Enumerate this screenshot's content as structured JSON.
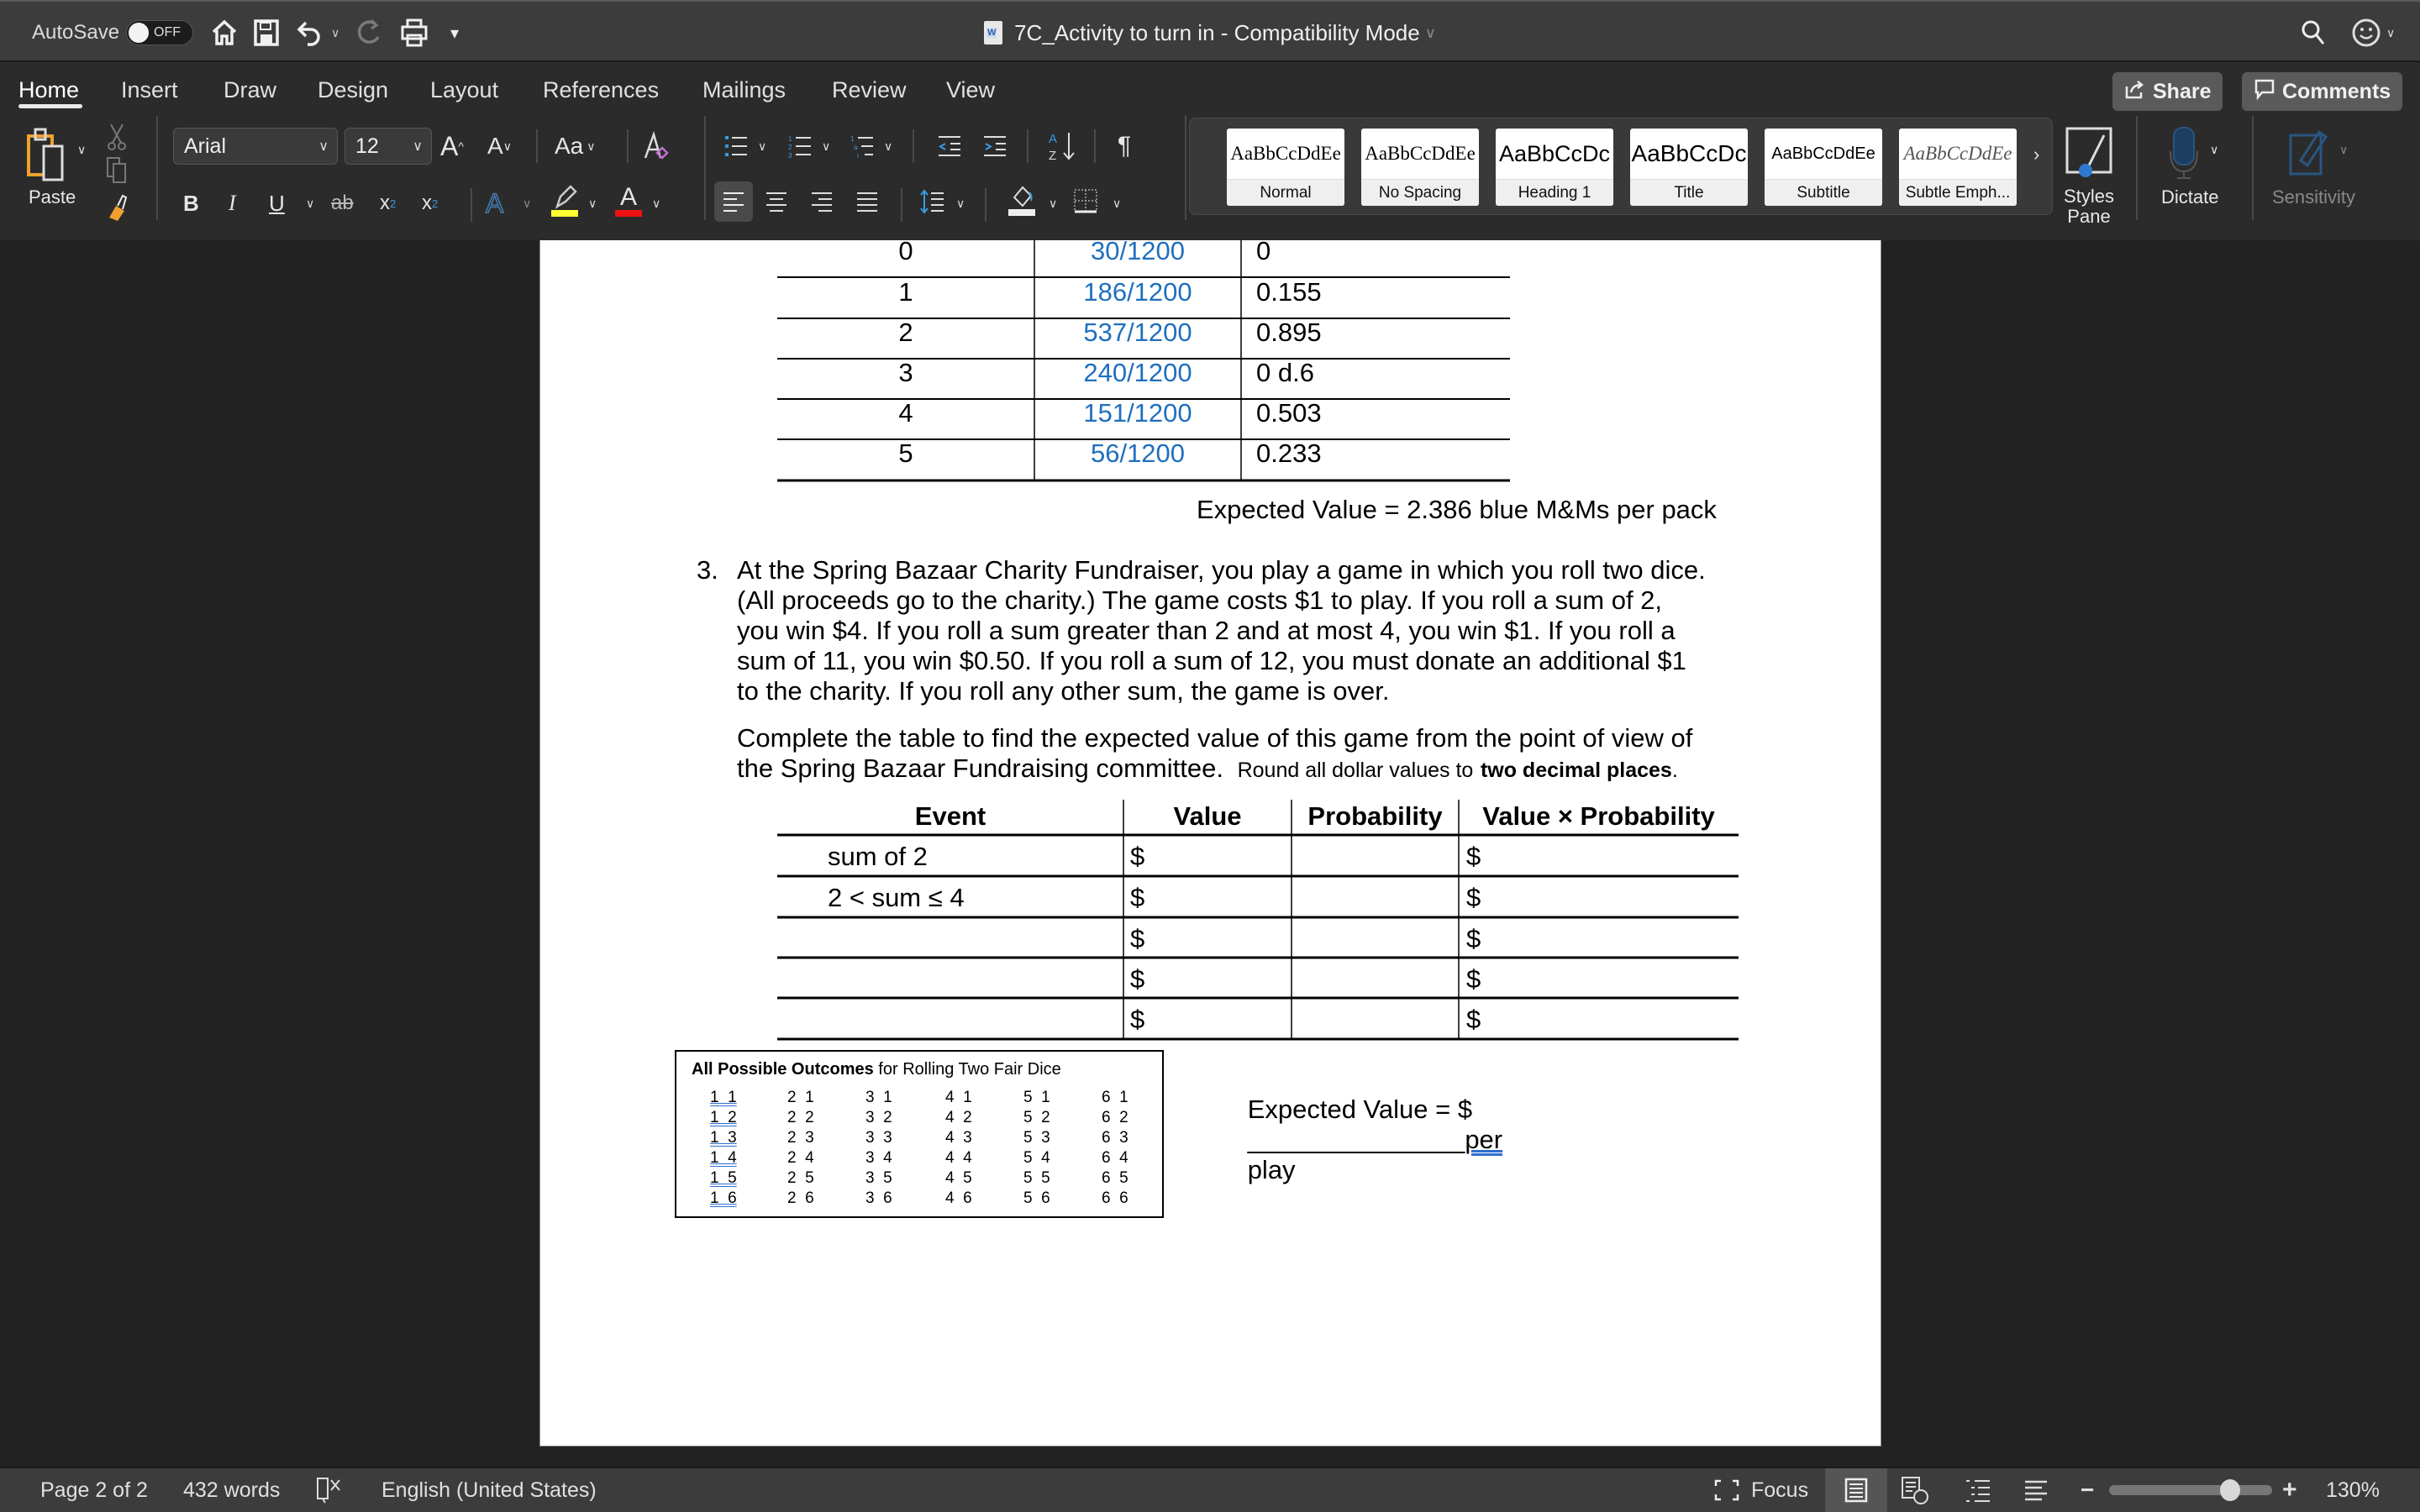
{
  "titlebar": {
    "autosave_label": "AutoSave",
    "autosave_state": "OFF",
    "doc_title": "7C_Activity to turn in  -  Compatibility Mode",
    "icons": [
      "home-icon",
      "save-icon",
      "undo-icon",
      "redo-icon",
      "print-icon",
      "customize-toolbar-icon",
      "search-icon",
      "feedback-smiley-icon"
    ]
  },
  "ribbon": {
    "tabs": [
      {
        "label": "Home",
        "active": true
      },
      {
        "label": "Insert"
      },
      {
        "label": "Draw"
      },
      {
        "label": "Design"
      },
      {
        "label": "Layout"
      },
      {
        "label": "References"
      },
      {
        "label": "Mailings"
      },
      {
        "label": "Review"
      },
      {
        "label": "View"
      }
    ],
    "share_label": "Share",
    "comments_label": "Comments",
    "paste_label": "Paste",
    "font_name": "Arial",
    "font_size": "12",
    "change_case_label": "Aa",
    "styles": [
      {
        "sample": "AaBbCcDdEe",
        "label": "Normal"
      },
      {
        "sample": "AaBbCcDdEe",
        "label": "No Spacing"
      },
      {
        "sample": "AaBbCcDc",
        "label": "Heading 1"
      },
      {
        "sample": "AaBbCcDc",
        "label": "Title"
      },
      {
        "sample": "AaBbCcDdEe",
        "label": "Subtitle"
      },
      {
        "sample": "AaBbCcDdEe",
        "label": "Subtle Emph..."
      }
    ],
    "styles_pane_label": "Styles Pane",
    "dictate_label": "Dictate",
    "sensitivity_label": "Sensitivity",
    "colors": {
      "highlight": "#ffff33",
      "font_color": "#ee1111"
    }
  },
  "document": {
    "prob_table": {
      "rows": [
        {
          "x": "0",
          "freq": "30/1200",
          "product": "0"
        },
        {
          "x": "1",
          "freq": "186/1200",
          "product": "0.155"
        },
        {
          "x": "2",
          "freq": "537/1200",
          "product": "0.895"
        },
        {
          "x": "3",
          "freq": "240/1200",
          "product": "0 d.6"
        },
        {
          "x": "4",
          "freq": "151/1200",
          "product": "0.503"
        },
        {
          "x": "5",
          "freq": "56/1200",
          "product": "0.233"
        }
      ]
    },
    "expected_value_mm": "Expected Value = 2.386 blue M&Ms per pack",
    "question_number": "3.",
    "question_text": "At the Spring Bazaar Charity Fundraiser, you play a game in which you roll two dice. (All proceeds go to the charity.) The game costs $1 to play. If you roll a sum of 2, you win $4. If you roll a sum greater than 2 and at most 4, you win $1. If you roll a sum of 11, you win $0.50. If you roll a sum of 12, you must donate an additional $1 to the charity. If you roll any other sum, the game is over.",
    "question_lines": [
      "At the Spring Bazaar Charity Fundraiser, you play a game in which you roll two dice.",
      "(All proceeds go to the charity.) The game costs $1 to play. If you roll a sum of 2,",
      "you win $4. If you roll a sum greater than 2 and at most 4, you win $1. If you roll a",
      "sum of 11, you win $0.50. If you roll a sum of 12, you must donate an additional $1",
      "to the charity. If you roll any other sum, the game is over."
    ],
    "instruction_line1": "Complete the table to find the expected value of this game from the point of view of",
    "instruction_line2": "the Spring Bazaar Fundraising committee.",
    "instruction_round_prefix": "Round all dollar values to",
    "instruction_round_bold": "two decimal places",
    "instruction_round_suffix": ".",
    "ev_table": {
      "headers": [
        "Event",
        "Value",
        "Probability",
        "Value × Probability"
      ],
      "rows": [
        {
          "event": "sum of 2",
          "value": "$",
          "probability": "",
          "vxp": "$"
        },
        {
          "event": "2 < sum ≤ 4",
          "value": "$",
          "probability": "",
          "vxp": "$"
        },
        {
          "event": "",
          "value": "$",
          "probability": "",
          "vxp": "$"
        },
        {
          "event": "",
          "value": "$",
          "probability": "",
          "vxp": "$"
        },
        {
          "event": "",
          "value": "$",
          "probability": "",
          "vxp": "$"
        }
      ]
    },
    "outcomes_box": {
      "title_bold": "All Possible Outcomes",
      "title_rest": " for Rolling Two Fair Dice",
      "columns": [
        [
          "1  1",
          "1  2",
          "1  3",
          "1  4",
          "1  5",
          "1  6"
        ],
        [
          "2  1",
          "2  2",
          "2  3",
          "2  4",
          "2  5",
          "2  6"
        ],
        [
          "3  1",
          "3  2",
          "3  3",
          "3  4",
          "3  5",
          "3  6"
        ],
        [
          "4  1",
          "4  2",
          "4  3",
          "4  4",
          "4  5",
          "4  6"
        ],
        [
          "5  1",
          "5  2",
          "5  3",
          "5  4",
          "5  5",
          "5  6"
        ],
        [
          "6  1",
          "6  2",
          "6  3",
          "6  4",
          "6  5",
          "6  6"
        ]
      ]
    },
    "ev_answer_prefix": "Expected Value = $",
    "ev_answer_blank": "_______________",
    "ev_answer_suffix": "per play"
  },
  "statusbar": {
    "page": "Page 2 of 2",
    "words": "432 words",
    "language": "English (United States)",
    "focus_label": "Focus",
    "zoom": "130%",
    "zoom_level_percent": 130
  }
}
